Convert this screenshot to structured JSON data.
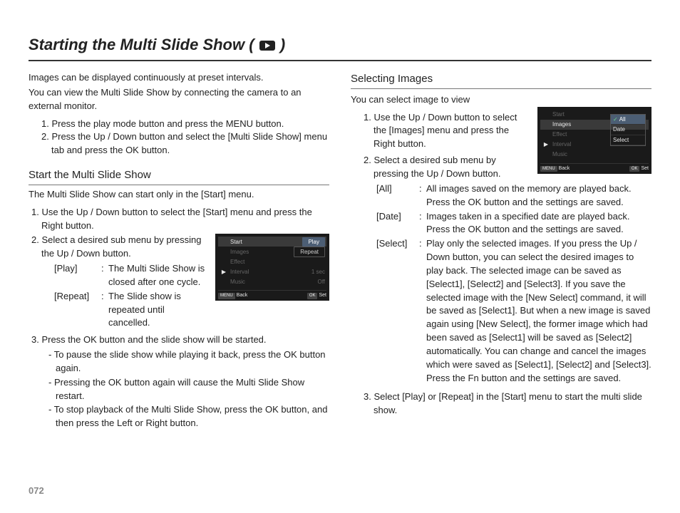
{
  "page_number": "072",
  "title": "Starting the Multi Slide Show (",
  "title_suffix": ")",
  "title_icon_name": "play-icon",
  "left": {
    "intro": [
      "Images can be displayed continuously at preset intervals.",
      "You can view the Multi Slide Show by connecting the camera to an external monitor."
    ],
    "steps_top": [
      "1. Press the play mode button and press the MENU button.",
      "2. Press the Up / Down button and select the [Multi Slide Show] menu tab and press the OK button."
    ],
    "subhead": "Start the Multi Slide Show",
    "body_intro": "The Multi Slide Show can start only in the [Start] menu.",
    "body_steps": {
      "s1": "1. Use the Up / Down button to select the [Start] menu and press the Right button.",
      "s2": "2. Select a desired sub menu by pressing the Up / Down button.",
      "defs": {
        "play_label": "[Play]",
        "play_text": "The Multi Slide Show is closed after one cycle.",
        "repeat_label": "[Repeat]",
        "repeat_text": "The Slide show is repeated until cancelled."
      },
      "s3": "3. Press the OK button and the slide show will be started.",
      "dash": [
        "- To pause the slide show while playing it back, press the OK button again.",
        "- Pressing the OK button again will cause the Multi Slide Show restart.",
        "- To stop playback of the Multi Slide Show, press the OK button, and then press the Left or Right button."
      ]
    },
    "ui": {
      "menu": [
        "Start",
        "Images",
        "Effect",
        "Interval",
        "Music"
      ],
      "highlight_index": 0,
      "right_vals": {
        "Interval": "1 sec",
        "Music": "Off"
      },
      "pills": [
        "Play",
        "Repeat"
      ],
      "footer_back": "Back",
      "footer_set": "Set",
      "menu_key": "MENU",
      "ok_key": "OK"
    }
  },
  "right": {
    "subhead": "Selecting Images",
    "intro": "You can select image to view",
    "s1": "1. Use the Up / Down button to select the [Images] menu and press the Right button.",
    "s2": "2. Select a desired sub menu by pressing the Up / Down button.",
    "defs": {
      "all_label": "[All]",
      "all_text": "All images saved on the memory are played back. Press the OK button and the settings are saved.",
      "date_label": "[Date]",
      "date_text": "Images taken in a specified date are played back. Press the OK button and the settings are saved.",
      "select_label": "[Select]",
      "select_text": "Play only the selected images. If you press the Up / Down button, you can select the desired images to play back. The selected image can be saved as [Select1], [Select2] and [Select3]. If you save the selected image with the [New Select] command, it will be saved as [Select1]. But when a new image is saved again using [New Select], the former image which had been saved as [Select1] will be saved as [Select2] automatically. You can change and cancel the images which were saved as [Select1], [Select2] and [Select3]. Press the Fn button and the settings are saved."
    },
    "s3": "3. Select [Play] or [Repeat] in the [Start] menu to start the multi slide show.",
    "ui": {
      "menu": [
        "Start",
        "Images",
        "Effect",
        "Interval",
        "Music"
      ],
      "highlight_index": 1,
      "submenu": [
        "All",
        "Date",
        "Select"
      ],
      "submenu_selected": 0,
      "footer_back": "Back",
      "footer_set": "Set",
      "menu_key": "MENU",
      "ok_key": "OK"
    }
  }
}
